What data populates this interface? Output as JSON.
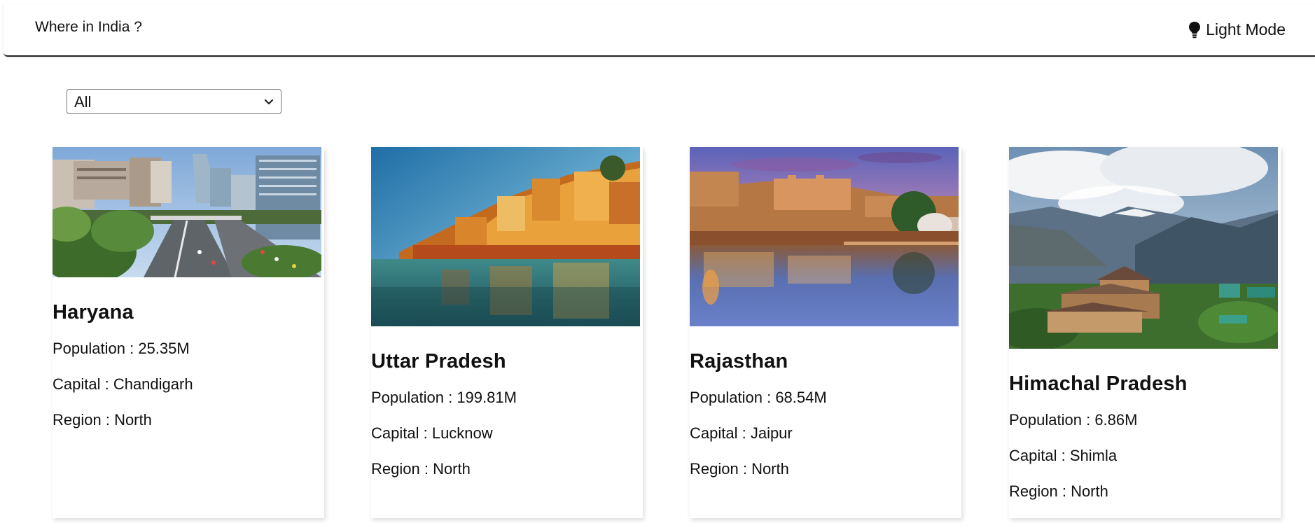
{
  "header": {
    "title": "Where in India ?",
    "mode_label": "Light Mode",
    "mode_icon": "lightbulb-icon"
  },
  "filter": {
    "selected": "All",
    "options": [
      "All"
    ]
  },
  "labels": {
    "population": "Population : ",
    "capital": "Capital : ",
    "region": "Region : "
  },
  "states": [
    {
      "name": "Haryana",
      "population": "25.35M",
      "capital": "Chandigarh",
      "region": "North",
      "image": "city-skyline-image"
    },
    {
      "name": "Uttar Pradesh",
      "population": "199.81M",
      "capital": "Lucknow",
      "region": "North",
      "image": "river-ghats-image"
    },
    {
      "name": "Rajasthan",
      "population": "68.54M",
      "capital": "Jaipur",
      "region": "North",
      "image": "fort-lake-image"
    },
    {
      "name": "Himachal Pradesh",
      "population": "6.86M",
      "capital": "Shimla",
      "region": "North",
      "image": "mountain-temple-image"
    }
  ]
}
